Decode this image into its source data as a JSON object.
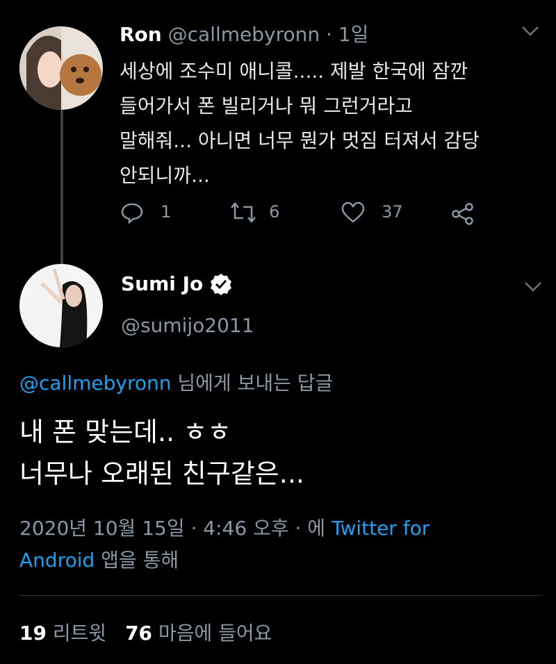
{
  "original_tweet": {
    "display_name": "Ron",
    "handle": "@callmebyronn",
    "separator": "·",
    "time": "1일",
    "text_lines": [
      "세상에 조수미 애니콜..... 제발 한국에 잠깐",
      "들어가서 폰 빌리거나 뭐 그런거라고",
      "말해줘... 아니면 너무 뭔가 멋짐 터져서 감당",
      "안되니까..."
    ],
    "reply_count": "1",
    "retweet_count": "6",
    "like_count": "37",
    "icons": [
      "reply-icon",
      "retweet-icon",
      "like-icon",
      "share-icon",
      "chevron-down-icon"
    ]
  },
  "reply_tweet": {
    "display_name": "Sumi Jo",
    "verified": true,
    "handle": "@sumijo2011",
    "replying_to_handle": "@callmebyronn",
    "replying_to_suffix": "님에게 보내는 답글",
    "text_lines": [
      "내 폰 맞는데.. ㅎㅎ",
      "너무나 오래된 친구같은..."
    ],
    "meta_date": "2020년 10월 15일 · 4:46 오후 · 에",
    "meta_source_1": "Twitter for",
    "meta_source_2": "Android",
    "meta_suffix": "앱을 통해",
    "retweets_num": "19",
    "retweets_label": "리트윗",
    "likes_num": "76",
    "likes_label": "마음에 들어요"
  },
  "colors": {
    "background": "#000000",
    "text": "#ffffff",
    "secondary": "#8b98a5",
    "link": "#1da1f2"
  }
}
